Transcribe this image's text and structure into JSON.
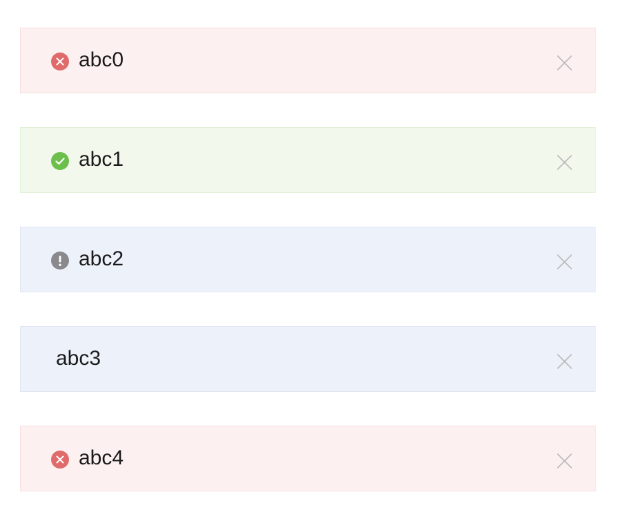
{
  "alerts": [
    {
      "text": "abc0",
      "type": "error",
      "icon": "close-circle-icon",
      "bg": "#fdf0f0",
      "border": "#f7dede",
      "icon_color": "#e06b6b"
    },
    {
      "text": "abc1",
      "type": "success",
      "icon": "check-circle-icon",
      "bg": "#f2f8ec",
      "border": "#e2f0d8",
      "icon_color": "#6cbf4a"
    },
    {
      "text": "abc2",
      "type": "info",
      "icon": "exclamation-circle-icon",
      "bg": "#edf1fa",
      "border": "#e0e6f2",
      "icon_color": "#8a8a8e"
    },
    {
      "text": "abc3",
      "type": "info",
      "icon": "",
      "bg": "#edf1fa",
      "border": "#e0e6f2",
      "icon_color": ""
    },
    {
      "text": "abc4",
      "type": "error",
      "icon": "close-circle-icon",
      "bg": "#fdf0f0",
      "border": "#f7dede",
      "icon_color": "#e06b6b"
    }
  ],
  "close_icon": "close-icon",
  "close_color": "#bdbdbd"
}
